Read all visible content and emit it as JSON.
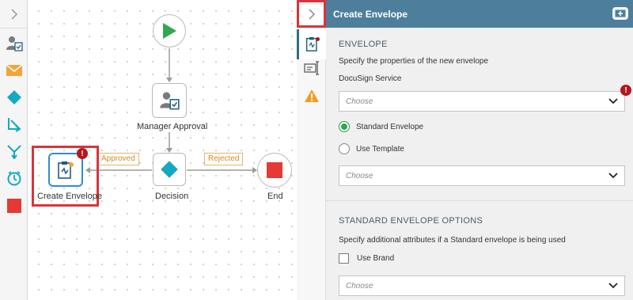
{
  "palette": {
    "tools": [
      {
        "icon": "user-approval-icon"
      },
      {
        "icon": "envelope-icon"
      },
      {
        "icon": "decision-diamond-icon"
      },
      {
        "icon": "branch-merge-icon"
      },
      {
        "icon": "branch-split-icon"
      },
      {
        "icon": "timer-icon"
      },
      {
        "icon": "stop-square-icon"
      }
    ]
  },
  "workflow": {
    "nodes": {
      "manager_approval": "Manager Approval",
      "decision": "Decision",
      "create_envelope": "Create Envelope",
      "end": "End"
    },
    "edges": {
      "approved": "Approved",
      "rejected": "Rejected"
    },
    "error_badge": "!"
  },
  "panel": {
    "title": "Create Envelope",
    "envelope_section": {
      "heading": "ENVELOPE",
      "description": "Specify the properties of the new envelope",
      "service_label": "DocuSign Service",
      "service_select": "Choose",
      "radio_standard": "Standard Envelope",
      "radio_template": "Use Template",
      "template_select": "Choose"
    },
    "options_section": {
      "heading": "STANDARD ENVELOPE OPTIONS",
      "description": "Specify additional attributes if a Standard envelope is being used",
      "use_brand_label": "Use Brand",
      "brand_select": "Choose"
    }
  },
  "colors": {
    "header": "#4d7e9c",
    "start": "#2fa84f",
    "decision": "#13a9c2",
    "end": "#e53935",
    "highlight": "#d9343a",
    "tag": "#d98b22",
    "error": "#b3161f"
  }
}
